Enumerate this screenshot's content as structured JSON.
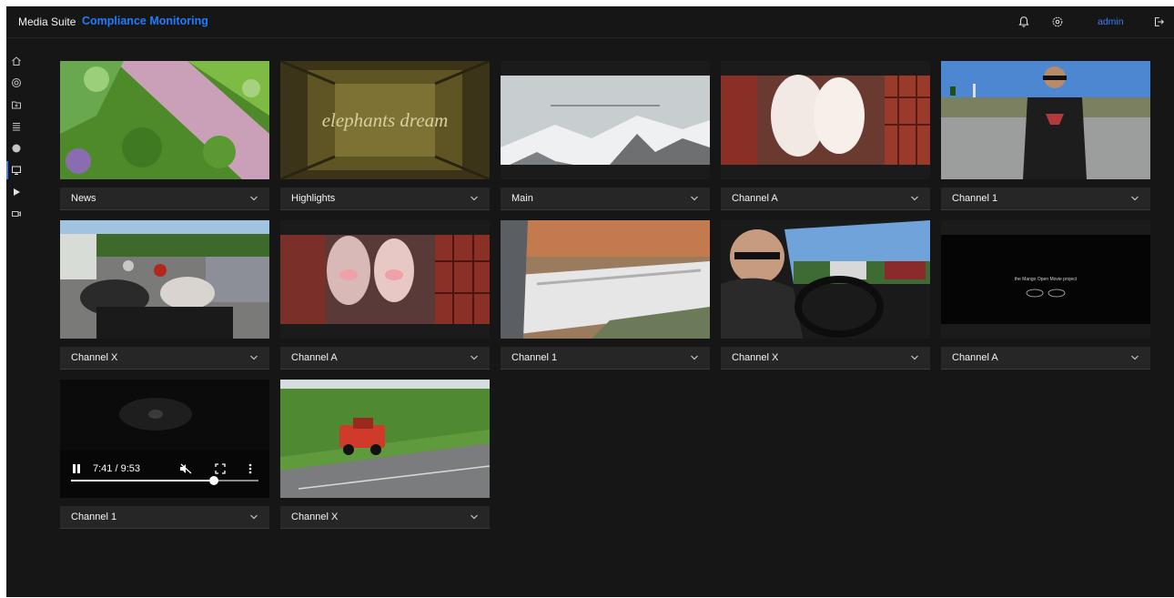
{
  "header": {
    "brand": "Media Suite",
    "product": "Compliance Monitoring",
    "user": "admin",
    "icons": [
      "bell-icon",
      "settings-icon",
      "logout-icon"
    ]
  },
  "sidebar": {
    "items": [
      {
        "icon": "home-icon",
        "active": false
      },
      {
        "icon": "target-icon",
        "active": false
      },
      {
        "icon": "folder-icon",
        "active": false
      },
      {
        "icon": "list-icon",
        "active": false
      },
      {
        "icon": "record-icon",
        "active": false
      },
      {
        "icon": "monitor-icon",
        "active": true
      },
      {
        "icon": "play-icon",
        "active": false
      },
      {
        "icon": "video-camera-icon",
        "active": false
      }
    ]
  },
  "colors": {
    "accent": "#1f7cff",
    "background": "#161616",
    "panel": "#262626"
  },
  "tiles": [
    {
      "channel": "News",
      "thumb": "garden"
    },
    {
      "channel": "Highlights",
      "thumb": "elephants"
    },
    {
      "channel": "Main",
      "thumb": "snow"
    },
    {
      "channel": "Channel A",
      "thumb": "steam"
    },
    {
      "channel": "Channel 1",
      "thumb": "man"
    },
    {
      "channel": "Channel X",
      "thumb": "traffic"
    },
    {
      "channel": "Channel A",
      "thumb": "steam2"
    },
    {
      "channel": "Channel 1",
      "thumb": "blur"
    },
    {
      "channel": "Channel X",
      "thumb": "driver"
    },
    {
      "channel": "Channel A",
      "thumb": "mango"
    },
    {
      "channel": "Channel 1",
      "thumb": "dark"
    },
    {
      "channel": "Channel X",
      "thumb": "truck"
    }
  ],
  "thumb_text": {
    "elephants": "elephants dream",
    "mango": "the Mango Open Movie project"
  },
  "player": {
    "time": "7:41 / 9:53",
    "progress": 0.76
  }
}
